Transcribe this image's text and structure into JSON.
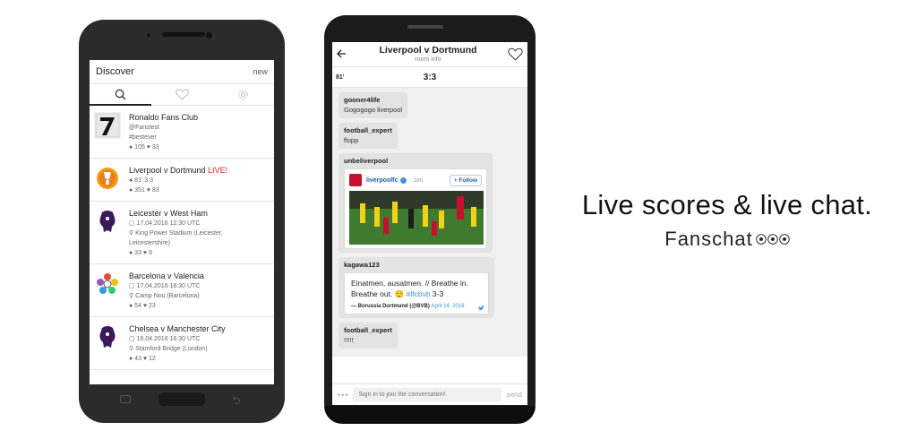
{
  "discover": {
    "title": "Discover",
    "new_label": "new",
    "tabs": [
      {
        "icon": "search-icon"
      },
      {
        "icon": "heart-icon"
      },
      {
        "icon": "gear-icon"
      }
    ],
    "items": [
      {
        "name": "Ronaldo Fans Club",
        "line1": "@Fanstest",
        "line2": "#bestever",
        "stats": "● 105 ♥ 33"
      },
      {
        "name": "Liverpool v Dortmund",
        "live": "LIVE!",
        "line1": "● 81' 3:3",
        "stats": "● 351 ♥ 83"
      },
      {
        "name": "Leicester v West Ham",
        "line1": "▢ 17.04.2016 12:30 UTC",
        "line2": "⚲ King Power Stadium (Leicester,",
        "line3": "Leicestershire)",
        "stats": "● 33 ♥ 9"
      },
      {
        "name": "Barcelona v Valencia",
        "line1": "▢ 17.04.2016 18:30 UTC",
        "line2": "⚲ Camp Nou (Barcelona)",
        "stats": "● 54 ♥ 23"
      },
      {
        "name": "Chelsea v Manchester City",
        "line1": "▢ 16.04.2016 16:30 UTC",
        "line2": "⚲ Stamford Bridge (London)",
        "stats": "● 43 ♥ 12"
      }
    ]
  },
  "room": {
    "title": "Liverpool v Dortmund",
    "subtitle": "room info",
    "minute": "81'",
    "score": "3:3",
    "messages": [
      {
        "user": "gooner4life",
        "text": "Gogogogo liverpool"
      },
      {
        "user": "football_expert",
        "text": "flopp"
      },
      {
        "user": "unbeliverpool"
      },
      {
        "user": "kagawa123"
      },
      {
        "user": "football_expert",
        "text": "!!!!!"
      }
    ],
    "tweet1": {
      "handle": "liverpoolfc",
      "time": "· 18h",
      "follow": "+ Follow"
    },
    "tweet2": {
      "text_a": "Einatmen, ausatmen. // Breathe in. Breathe out. 😌 ",
      "hashtag": "#lfcbvb",
      "text_b": " 3-3",
      "source": "— Borussia Dortmund (@BVB)",
      "date": "April 14, 2016"
    },
    "composer_placeholder": "Sign in to join the conversation!",
    "send_label": "send"
  },
  "tagline": {
    "main": "Live scores & live chat.",
    "brand": "Fanschat"
  },
  "colors": {
    "live": "#d9262d",
    "twitter_blue": "#3b94d9"
  }
}
